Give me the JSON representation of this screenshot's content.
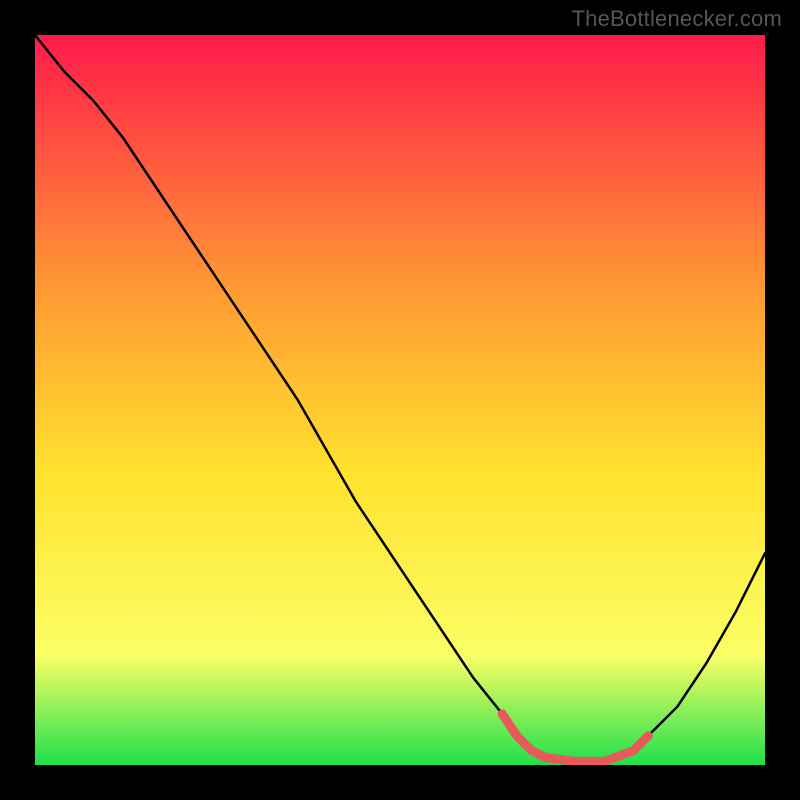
{
  "attribution": "TheBottlenecker.com",
  "colors": {
    "gradient_top": "#ff1a4a",
    "gradient_mid_upper": "#ff9a33",
    "gradient_mid": "#ffe22e",
    "gradient_mid_lower": "#fbff66",
    "gradient_bottom": "#1fe04b",
    "curve": "#000000",
    "highlight": "#e85a5a",
    "frame": "#000000"
  },
  "chart_data": {
    "type": "line",
    "title": "",
    "xlabel": "",
    "ylabel": "",
    "xlim": [
      0,
      100
    ],
    "ylim": [
      0,
      100
    ],
    "series": [
      {
        "name": "bottleneck-curve",
        "x": [
          0,
          4,
          8,
          12,
          16,
          20,
          24,
          28,
          32,
          36,
          40,
          44,
          48,
          52,
          56,
          60,
          64,
          66,
          68,
          70,
          74,
          78,
          82,
          84,
          88,
          92,
          96,
          100
        ],
        "y": [
          100,
          95,
          91,
          86,
          80,
          74,
          68,
          62,
          56,
          50,
          43,
          36,
          30,
          24,
          18,
          12,
          7,
          4,
          2,
          1,
          0.5,
          0.5,
          2,
          4,
          8,
          14,
          21,
          29
        ]
      }
    ],
    "highlight_segment": {
      "name": "optimal-range",
      "x": [
        64,
        66,
        68,
        70,
        74,
        78,
        82,
        84
      ],
      "y": [
        7,
        4,
        2,
        1,
        0.5,
        0.5,
        2,
        4
      ]
    }
  }
}
